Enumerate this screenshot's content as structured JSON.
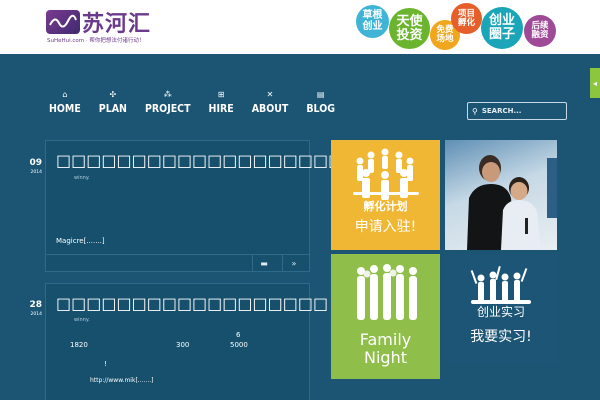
{
  "header": {
    "logo_text": "苏河汇",
    "logo_sub": "SuHeHui.com · 帮你把想法付诸行动！",
    "bubbles": [
      "草根\n创业",
      "天使\n投资",
      "免费\n场地",
      "项目\n孵化",
      "创业\n圈子",
      "后续\n融资"
    ]
  },
  "nav": {
    "items": [
      {
        "label": "HOME",
        "icon": "home-icon"
      },
      {
        "label": "PLAN",
        "icon": "share-icon"
      },
      {
        "label": "PROJECT",
        "icon": "network-icon"
      },
      {
        "label": "HIRE",
        "icon": "hierarchy-icon"
      },
      {
        "label": "ABOUT",
        "icon": "cross-icon"
      },
      {
        "label": "BLOG",
        "icon": "document-icon"
      }
    ],
    "search_placeholder": "SEARCH..."
  },
  "posts": [
    {
      "day": "09",
      "year": "2014",
      "title": "□□□□□□□□□□□□□□□□□□□□□",
      "author": "winny.",
      "lines": [
        "Magicre[.......]"
      ]
    },
    {
      "day": "28",
      "year": "2014",
      "title": "□□□□□□□□□□□□□□□□□□",
      "author": "winny.",
      "lines": [
        "6",
        "1820",
        "300",
        "5000",
        "!",
        "http://www.mik[.......]"
      ]
    }
  ],
  "tiles": {
    "incubation": {
      "title": "孵化计划",
      "sub": "申请入驻!"
    },
    "family": {
      "title_line1": "Family",
      "title_line2": "Night"
    },
    "internship": {
      "title": "创业实习",
      "sub": "我要实习!"
    }
  },
  "colors": {
    "background": "#1b5573",
    "tile_yellow": "#f0b734",
    "tile_green": "#8fbe4a",
    "tile_navy": "#1d5576"
  }
}
